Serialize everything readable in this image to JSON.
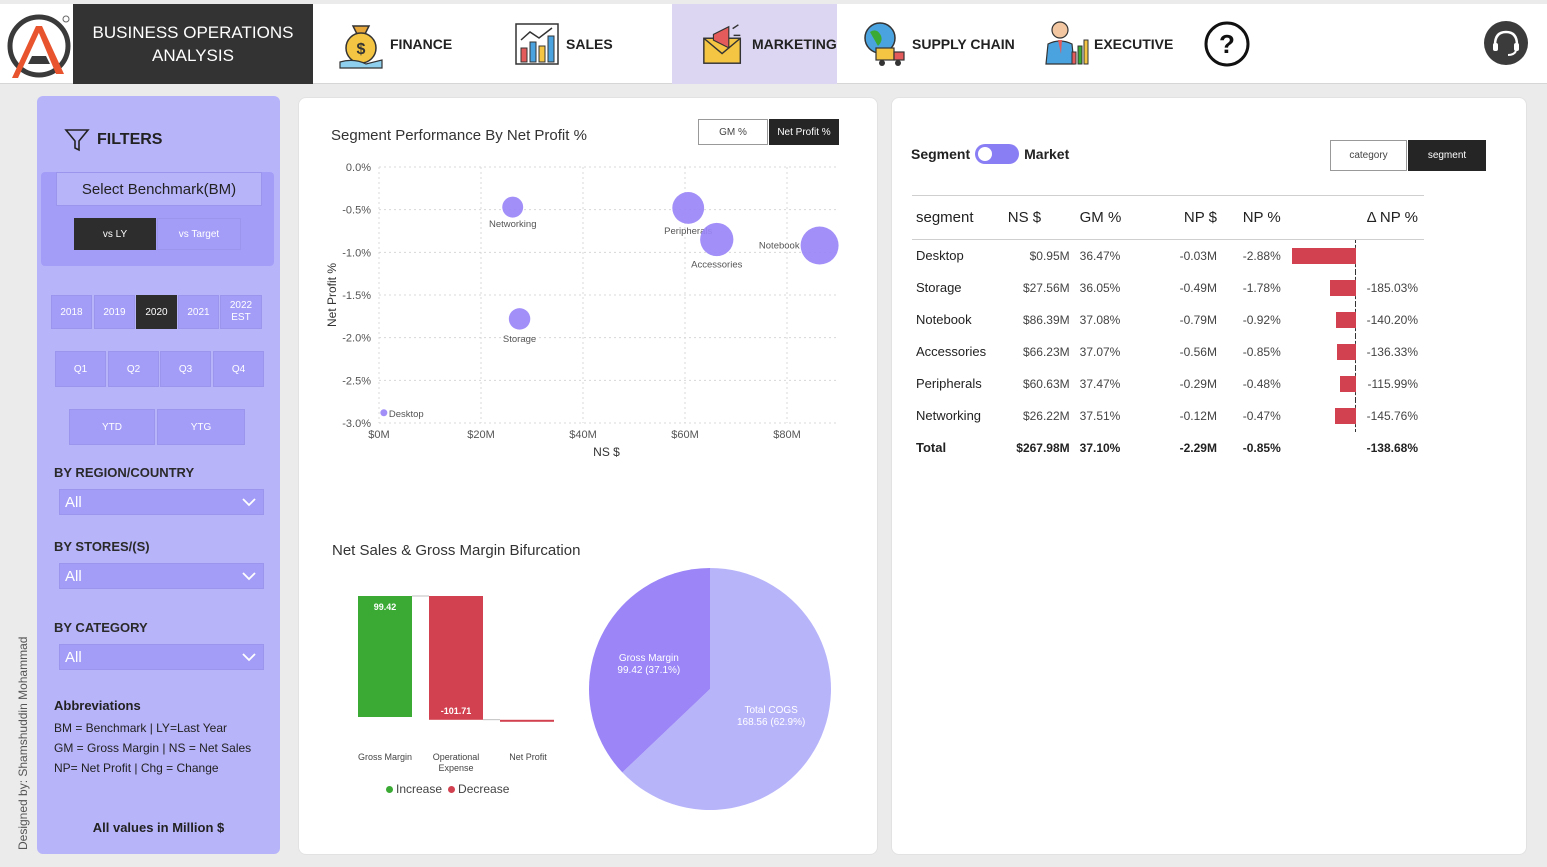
{
  "header": {
    "brand_line1": "BUSINESS OPERATIONS",
    "brand_line2": "ANALYSIS",
    "nav": [
      {
        "label": "FINANCE",
        "icon": "money-bag-icon"
      },
      {
        "label": "SALES",
        "icon": "bar-chart-icon"
      },
      {
        "label": "MARKETING",
        "icon": "megaphone-envelope-icon",
        "active": true
      },
      {
        "label": "SUPPLY CHAIN",
        "icon": "globe-truck-icon"
      },
      {
        "label": "EXECUTIVE",
        "icon": "executive-icon"
      }
    ],
    "help_symbol": "?"
  },
  "filters": {
    "title": "FILTERS",
    "benchmark_label": "Select Benchmark(BM)",
    "benchmark_options": [
      "vs LY",
      "vs Target"
    ],
    "benchmark_selected": "vs LY",
    "years": [
      "2018",
      "2019",
      "2020",
      "2021",
      "2022",
      "EST"
    ],
    "year_selected": "2020",
    "quarters": [
      "Q1",
      "Q2",
      "Q3",
      "Q4"
    ],
    "periods": [
      "YTD",
      "YTG"
    ],
    "region_label": "BY REGION/COUNTRY",
    "region_value": "All",
    "stores_label": "BY STORES/(S)",
    "stores_value": "All",
    "category_label": "BY CATEGORY",
    "category_value": "All",
    "abbr_title": "Abbreviations",
    "abbr_lines": [
      "BM = Benchmark | LY=Last Year",
      "GM = Gross Margin | NS = Net Sales",
      "NP= Net Profit | Chg = Change"
    ],
    "all_values_note": "All values in Million $",
    "designed_by": "Designed by: Shamshuddin Mohammad"
  },
  "scatter_card": {
    "title": "Segment Performance By Net Profit %",
    "toggle_options": [
      "GM %",
      "Net Profit %"
    ],
    "toggle_selected": "Net Profit %"
  },
  "waterfall_card": {
    "title": "Net Sales & Gross Margin Bifurcation",
    "legend_increase": "Increase",
    "legend_decrease": "Decrease"
  },
  "table_card": {
    "switch_left": "Segment",
    "switch_right": "Market",
    "view_options": [
      "category",
      "segment"
    ],
    "view_selected": "segment",
    "columns": [
      "segment",
      "NS $",
      "GM %",
      "NP $",
      "NP %",
      "Δ NP %"
    ],
    "rows": [
      {
        "segment": "Desktop",
        "ns": "$0.95M",
        "gm": "36.47%",
        "np": "-0.03M",
        "npp": "-2.88%",
        "delta": "",
        "delta_value": -450
      },
      {
        "segment": "Storage",
        "ns": "$27.56M",
        "gm": "36.05%",
        "np": "-0.49M",
        "npp": "-1.78%",
        "delta": "-185.03%",
        "delta_value": -185.03
      },
      {
        "segment": "Notebook",
        "ns": "$86.39M",
        "gm": "37.08%",
        "np": "-0.79M",
        "npp": "-0.92%",
        "delta": "-140.20%",
        "delta_value": -140.2
      },
      {
        "segment": "Accessories",
        "ns": "$66.23M",
        "gm": "37.07%",
        "np": "-0.56M",
        "npp": "-0.85%",
        "delta": "-136.33%",
        "delta_value": -136.33
      },
      {
        "segment": "Peripherals",
        "ns": "$60.63M",
        "gm": "37.47%",
        "np": "-0.29M",
        "npp": "-0.48%",
        "delta": "-115.99%",
        "delta_value": -115.99
      },
      {
        "segment": "Networking",
        "ns": "$26.22M",
        "gm": "37.51%",
        "np": "-0.12M",
        "npp": "-0.47%",
        "delta": "-145.76%",
        "delta_value": -145.76
      }
    ],
    "total": {
      "segment": "Total",
      "ns": "$267.98M",
      "gm": "37.10%",
      "np": "-2.29M",
      "npp": "-0.85%",
      "delta": "-138.68%"
    }
  },
  "colors": {
    "accent": "#a49df7",
    "panel": "#b8b4fa",
    "increase": "#3aaa35",
    "decrease": "#d1414f",
    "pie_gm": "#9b85f7",
    "pie_cogs": "#b8b4fa",
    "active_nav": "#ddd6f3",
    "dark": "#333333"
  },
  "chart_data": [
    {
      "type": "scatter",
      "title": "Segment Performance By Net Profit %",
      "xlabel": "NS $",
      "ylabel": "Net Profit %",
      "xlim": [
        0,
        90
      ],
      "ylim": [
        -3.0,
        0.0
      ],
      "x_ticks": [
        "$0M",
        "$20M",
        "$40M",
        "$60M",
        "$80M"
      ],
      "y_ticks": [
        "0.0%",
        "-0.5%",
        "-1.0%",
        "-1.5%",
        "-2.0%",
        "-2.5%",
        "-3.0%"
      ],
      "grid": true,
      "points": [
        {
          "label": "Networking",
          "x": 26.22,
          "y": -0.47,
          "size": 26.22
        },
        {
          "label": "Peripherals",
          "x": 60.63,
          "y": -0.48,
          "size": 60.63
        },
        {
          "label": "Accessories",
          "x": 66.23,
          "y": -0.85,
          "size": 66.23
        },
        {
          "label": "Notebook",
          "x": 86.39,
          "y": -0.92,
          "size": 86.39
        },
        {
          "label": "Storage",
          "x": 27.56,
          "y": -1.78,
          "size": 27.56
        },
        {
          "label": "Desktop",
          "x": 0.95,
          "y": -2.88,
          "size": 0.95
        }
      ]
    },
    {
      "type": "bar",
      "subtype": "waterfall",
      "title": "Net Sales & Gross Margin Bifurcation",
      "categories": [
        "Gross Margin",
        "Operational Expense",
        "Net Profit"
      ],
      "values": [
        99.42,
        -101.71,
        -2.29
      ],
      "labels": [
        "99.42",
        "-101.71",
        ""
      ],
      "legend": [
        "Increase",
        "Decrease"
      ]
    },
    {
      "type": "pie",
      "slices": [
        {
          "label": "Gross Margin",
          "value": 99.42,
          "text": "99.42 (37.1%)"
        },
        {
          "label": "Total COGS",
          "value": 168.56,
          "text": "168.56 (62.9%)"
        }
      ]
    }
  ]
}
